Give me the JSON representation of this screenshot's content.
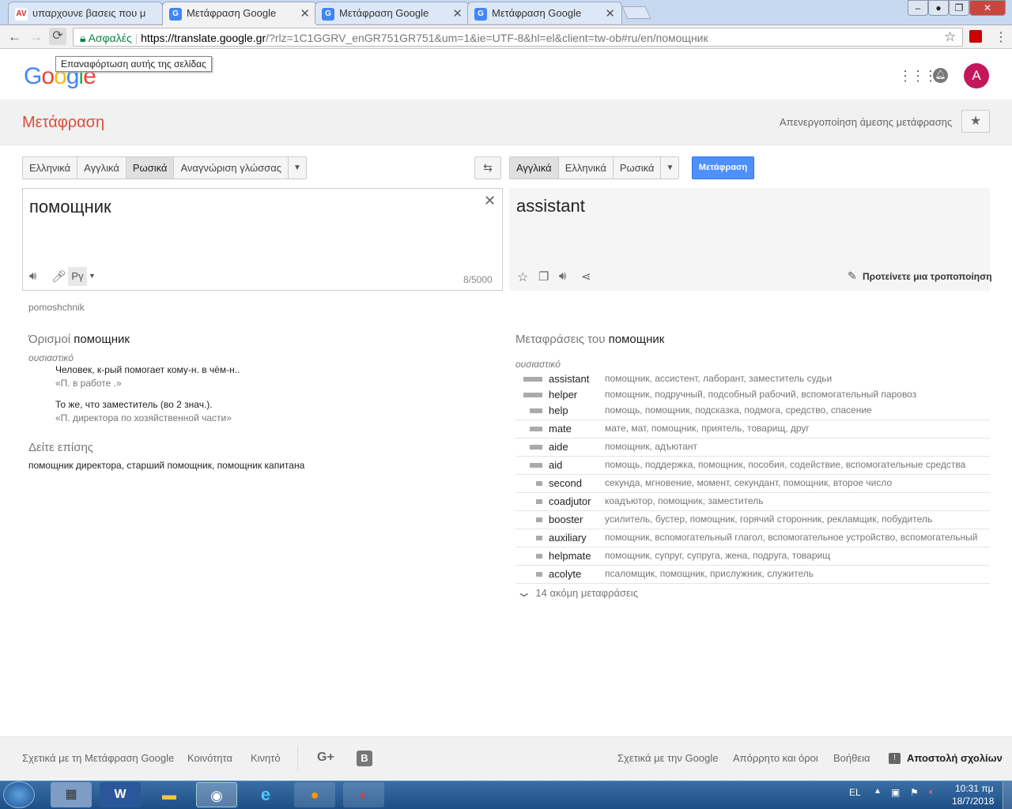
{
  "browser": {
    "tabs": [
      {
        "label": "υπαρχουνε βασεις που μ",
        "favicon": "AV",
        "favcolor": "#d7262e"
      },
      {
        "label": "Μετάφραση Google",
        "favicon": "G",
        "favcolor": "#4285f4"
      },
      {
        "label": "Μετάφραση Google",
        "favicon": "G",
        "favcolor": "#4285f4"
      },
      {
        "label": "Μετάφραση Google",
        "favicon": "G",
        "favcolor": "#4285f4"
      }
    ],
    "secure_label": "Ασφαλές",
    "url_host": "https://translate.google.gr",
    "url_rest": "/?rlz=1C1GGRV_enGR751GR751&um=1&ie=UTF-8&hl=el&client=tw-ob#ru/en/помощник",
    "reload_tooltip": "Επαναφόρτωση αυτής της σελίδας"
  },
  "header": {
    "logo": "Google",
    "avatar_letter": "A"
  },
  "page": {
    "title": "Μετάφραση",
    "instant_toggle": "Απενεργοποίηση άμεσης μετάφρασης"
  },
  "source_langs": [
    "Ελληνικά",
    "Αγγλικά",
    "Ρωσικά",
    "Αναγνώριση γλώσσας"
  ],
  "target_langs": [
    "Αγγλικά",
    "Ελληνικά",
    "Ρωσικά"
  ],
  "translate_button": "Μετάφραση",
  "source": {
    "text": "помощник",
    "char_count": "8/5000",
    "input_tool": "Рү",
    "transliteration": "pomoshchnik"
  },
  "target": {
    "text": "assistant",
    "suggest": "Προτείνετε μια τροποποίηση"
  },
  "definitions": {
    "title_prefix": "Όρισμοί",
    "title_word": "помощник",
    "pos": "ουσιαστικό",
    "items": [
      {
        "def": "Человек, к-рый помогает кому-н. в чём-н..",
        "example": "«П. в работе .»"
      },
      {
        "def": "То же, что заместитель (во 2 знач.).",
        "example": "«П. директора по хозяйственной части»"
      }
    ],
    "see_also_title": "Δείτε επίσης",
    "see_also": "помощник директора, старший помощник, помощник капитана"
  },
  "translations": {
    "title_prefix": "Μεταφράσεις του",
    "title_word": "помощник",
    "pos": "ουσιαστικό",
    "rows": [
      {
        "word": "assistant",
        "syn": "помощник, ассистент, лаборант, заместитель судьи",
        "freq": 1.0
      },
      {
        "word": "helper",
        "syn": "помощник, подручный, подсобный рабочий, вспомогательный паровоз",
        "freq": 1.0
      },
      {
        "word": "help",
        "syn": "помощь, помощник, подсказка, подмога, средство, спасение",
        "freq": 0.67
      },
      {
        "word": "mate",
        "syn": "мате, мат, помощник, приятель, товарищ, друг",
        "freq": 0.67
      },
      {
        "word": "aide",
        "syn": "помощник, адъютант",
        "freq": 0.67
      },
      {
        "word": "aid",
        "syn": "помощь, поддержка, помощник, пособия, содействие, вспомогательные средства",
        "freq": 0.67
      },
      {
        "word": "second",
        "syn": "секунда, мгновение, момент, секундант, помощник, второе число",
        "freq": 0.33
      },
      {
        "word": "coadjutor",
        "syn": "коадъютор, помощник, заместитель",
        "freq": 0.33
      },
      {
        "word": "booster",
        "syn": "усилитель, бустер, помощник, горячий сторонник, рекламщик, побудитель",
        "freq": 0.33
      },
      {
        "word": "auxiliary",
        "syn": "помощник, вспомогательный глагол, вспомогательное устройство, вспомогательный",
        "freq": 0.33
      },
      {
        "word": "helpmate",
        "syn": "помощник, супруг, супруга, жена, подруга, товарищ",
        "freq": 0.33
      },
      {
        "word": "acolyte",
        "syn": "псаломщик, помощник, прислужник, служитель",
        "freq": 0.33
      }
    ],
    "more": "14 ακόμη μεταφράσεις"
  },
  "footer": {
    "about": "Σχετικά με τη Μετάφραση Google",
    "community": "Κοινότητα",
    "mobile": "Κινητό",
    "about_google": "Σχετικά με την Google",
    "privacy": "Απόρρητο και όροι",
    "help": "Βοήθεια",
    "feedback": "Αποστολή σχολίων"
  },
  "taskbar": {
    "lang": "EL",
    "time": "10:31 πμ",
    "date": "18/7/2018"
  }
}
